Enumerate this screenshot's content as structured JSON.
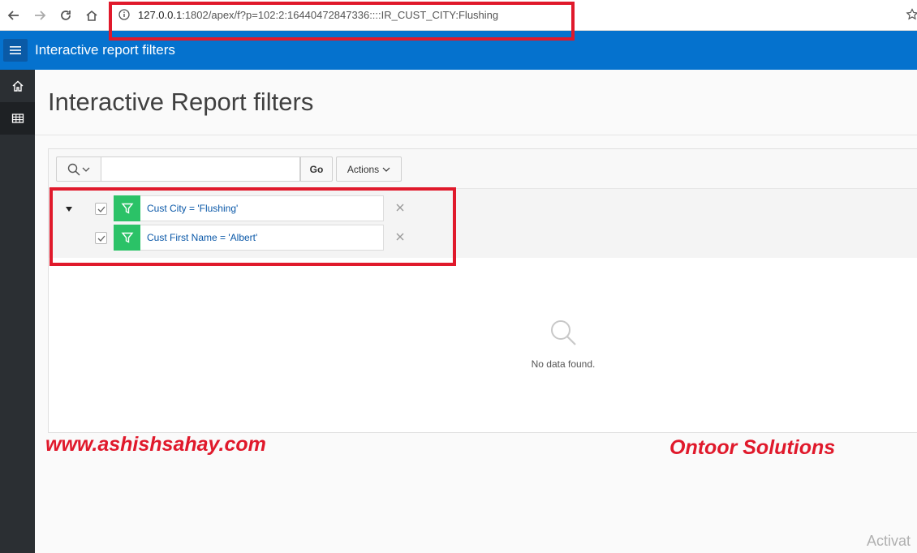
{
  "browser": {
    "url_host": "127.0.0.1",
    "url_rest": ":1802/apex/f?p=102:2:16440472847336::::IR_CUST_CITY:Flushing"
  },
  "app": {
    "title": "Interactive report filters"
  },
  "sidebar": {
    "items": [
      {
        "icon": "home-icon"
      },
      {
        "icon": "table-icon",
        "active": true
      }
    ]
  },
  "page": {
    "title": "Interactive Report filters"
  },
  "toolbar": {
    "search_value": "",
    "go_label": "Go",
    "actions_label": "Actions"
  },
  "filters": [
    {
      "label": "Cust City = 'Flushing'",
      "checked": true
    },
    {
      "label": "Cust First Name = 'Albert'",
      "checked": true
    }
  ],
  "report": {
    "no_data": "No data found."
  },
  "overlay": {
    "website": "www.ashishsahay.com",
    "company": "Ontoor Solutions",
    "os_notice": "Activat"
  },
  "colors": {
    "header": "#0572ce",
    "filter_badge": "#2bc267",
    "highlight": "#e0192b"
  }
}
